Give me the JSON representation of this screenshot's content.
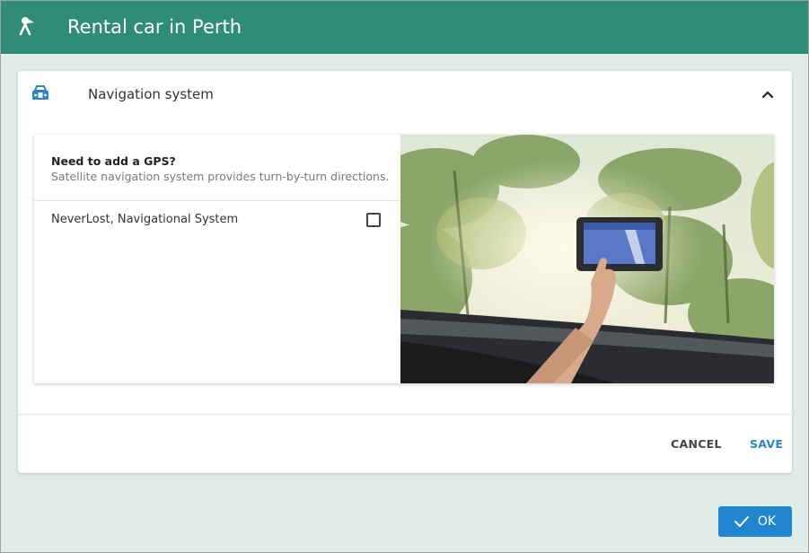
{
  "header": {
    "title": "Rental car in Perth",
    "icon": "person-pin-icon"
  },
  "panel": {
    "title": "Navigation system",
    "icon": "car-front-icon",
    "collapse_icon": "chevron-up-icon",
    "card": {
      "question": "Need to add a GPS?",
      "description": "Satellite navigation system provides turn-by-turn directions.",
      "option_label": "NeverLost, Navigational System",
      "option_checked": false,
      "image": "gps-in-car-photo"
    },
    "cancel_label": "CANCEL",
    "save_label": "SAVE"
  },
  "footer": {
    "ok_label": "OK",
    "ok_icon": "check-icon"
  },
  "colors": {
    "header_bg": "#2f8c77",
    "page_bg": "#dfece9",
    "accent_blue": "#2185d0"
  }
}
